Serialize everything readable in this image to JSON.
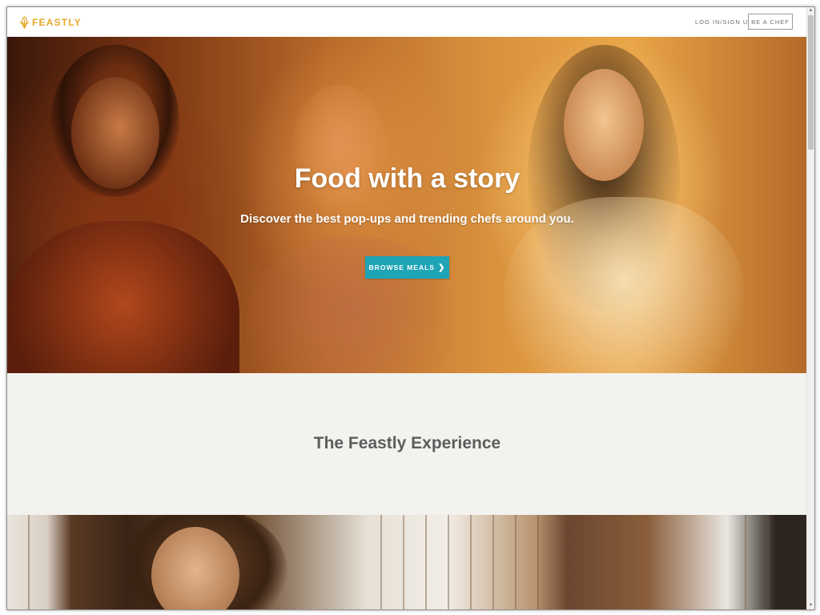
{
  "header": {
    "logo_text": "FEASTLY",
    "login_label": "LOG IN/SIGN UP",
    "be_chef_label": "BE A CHEF"
  },
  "hero": {
    "title": "Food with a story",
    "subtitle": "Discover the best pop-ups and trending chefs around you.",
    "browse_label": "BROWSE MEALS",
    "browse_icon": "chevron-right-icon"
  },
  "experience": {
    "title": "The Feastly Experience"
  },
  "colors": {
    "brand": "#e6a92b",
    "accent": "#1fa4b5",
    "heading_gray": "#5d5d5d"
  }
}
